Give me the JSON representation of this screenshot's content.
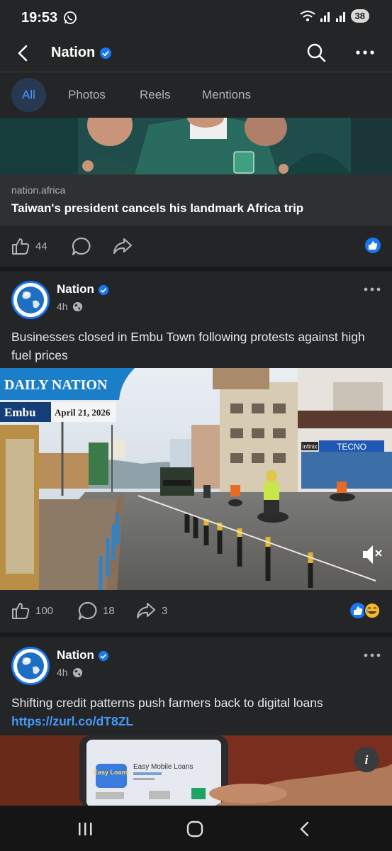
{
  "status_bar": {
    "time": "19:53",
    "battery": "38"
  },
  "header": {
    "title": "Nation"
  },
  "tabs": [
    {
      "label": "All",
      "active": true
    },
    {
      "label": "Photos",
      "active": false
    },
    {
      "label": "Reels",
      "active": false
    },
    {
      "label": "Mentions",
      "active": false
    }
  ],
  "posts": [
    {
      "link_domain": "nation.africa",
      "link_title": "Taiwan's president cancels his landmark Africa trip",
      "like_count": "44"
    },
    {
      "page_name": "Nation",
      "time": "4h",
      "text": "Businesses closed in Embu Town following protests against high fuel prices",
      "image": {
        "brand": "DAILY NATION",
        "location": "Embu",
        "date": "April 21, 2026",
        "shop_sign": "TECNO",
        "shop_sign_2": "infinix"
      },
      "like_count": "100",
      "comment_count": "18",
      "share_count": "3"
    },
    {
      "page_name": "Nation",
      "time": "4h",
      "text": "Shifting credit patterns push farmers back to digital loans",
      "link": "https://zurl.co/dT8ZL",
      "image": {
        "app_name": "Easy Mobile Loans",
        "app_logo_text": "Easy Loans"
      }
    }
  ],
  "colors": {
    "accent": "#1877f2",
    "link": "#4599ff",
    "card_bg": "#242526"
  }
}
